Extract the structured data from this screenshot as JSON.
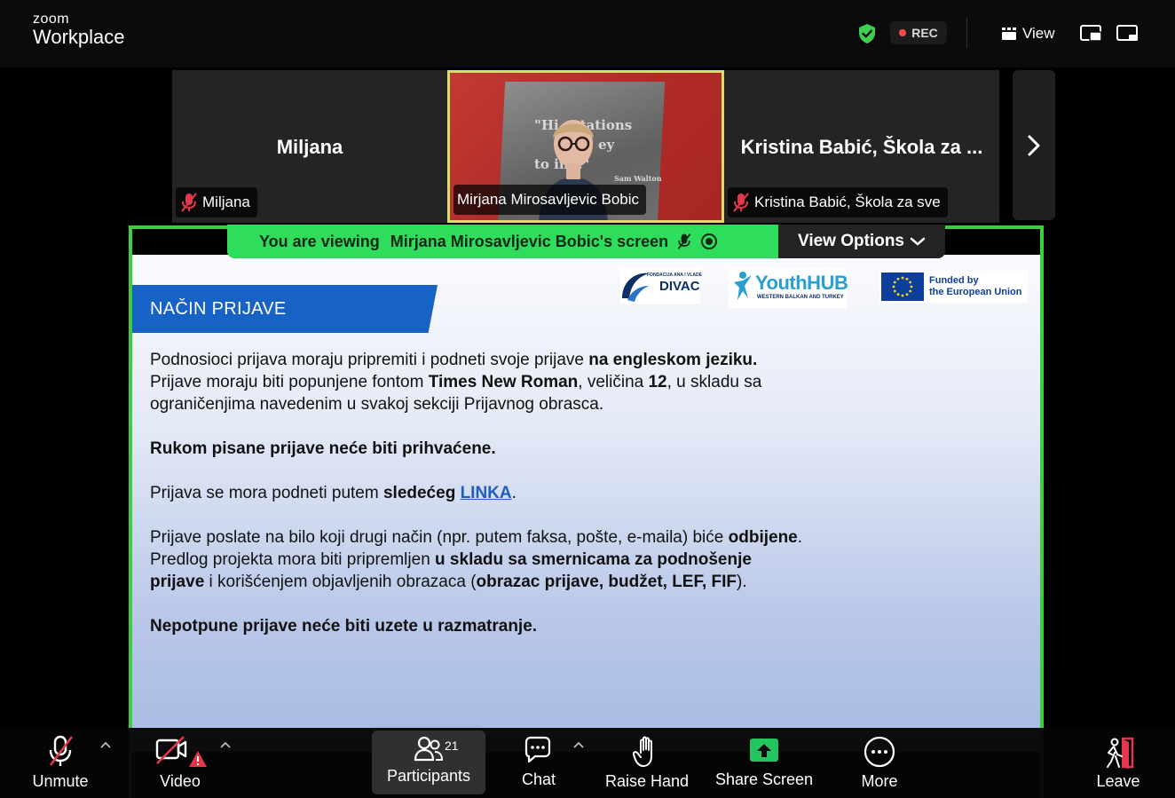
{
  "app": {
    "logo_small": "zoom",
    "logo_large": "Workplace"
  },
  "topbar": {
    "rec_label": "REC",
    "view_label": "View",
    "colors": {
      "shield": "#3ecf4f",
      "rec_dot": "#ff4a4a"
    }
  },
  "thumbnails": [
    {
      "name_big": "Miljana",
      "label": "Miljana",
      "muted": true
    },
    {
      "label": "Mirjana Mirosavljevic Bobic",
      "active": true,
      "poster_lines": [
        "\"Hi ectations",
        "ey",
        "to ing.\"",
        "Sam Walton"
      ]
    },
    {
      "name_big": "Kristina Babić, Škola za ...",
      "label": "Kristina Babić, Škola za sve",
      "muted": true
    }
  ],
  "share": {
    "viewing_prefix": "You are viewing",
    "viewing_name": "Mirjana Mirosavljevic Bobic's screen",
    "view_options": "View Options",
    "accent": "#3ccf3c"
  },
  "slide": {
    "title": "NAČIN PRIJAVE",
    "logos": {
      "divac_small": "FONDACIJA ANA I VLADE",
      "divac_large": "DIVAC",
      "youthhub": "YouthHUB",
      "youthhub_sub": "WESTERN BALKAN AND TURKEY",
      "eu_line1": "Funded by",
      "eu_line2": "the European Union"
    },
    "p1_a": "Podnosioci prijava moraju pripremiti i podneti svoje prijave ",
    "p1_b": "na engleskom jeziku.",
    "p2_a": "Prijave moraju biti popunjene fontom ",
    "p2_b": "Times New Roman",
    "p2_c": ", veličina ",
    "p2_d": "12",
    "p2_e": ", u skladu sa ograničenjima navedenim u svakoj sekciji Prijavnog obrasca.",
    "p3": "Rukom pisane prijave neće biti prihvaćene.",
    "p4_a": "Prijava se mora podneti putem ",
    "p4_b": "sledećeg",
    "p4_link": "LINKA",
    "p4_c": ".",
    "p5_a": "Prijave poslate na bilo koji drugi način (npr. putem faksa, pošte, e-maila) biće ",
    "p5_b": "odbijene",
    "p5_c": ".",
    "p6_a": "Predlog projekta mora biti pripremljen ",
    "p6_b": "u skladu sa smernicama za podnošenje prijave",
    "p6_c": " i korišćenjem objavljenih obrazaca (",
    "p6_d": "obrazac prijave, budžet, LEF, FIF",
    "p6_e": ").",
    "p7": "Nepotpune prijave neće biti uzete u razmatranje."
  },
  "toolbar": {
    "unmute": "Unmute",
    "video": "Video",
    "participants": "Participants",
    "participants_count": "21",
    "chat": "Chat",
    "raise_hand": "Raise Hand",
    "share_screen": "Share Screen",
    "more": "More",
    "leave": "Leave",
    "colors": {
      "share_green": "#22c55e",
      "alert_red": "#e5364b",
      "leave_red": "#e5364b"
    }
  }
}
